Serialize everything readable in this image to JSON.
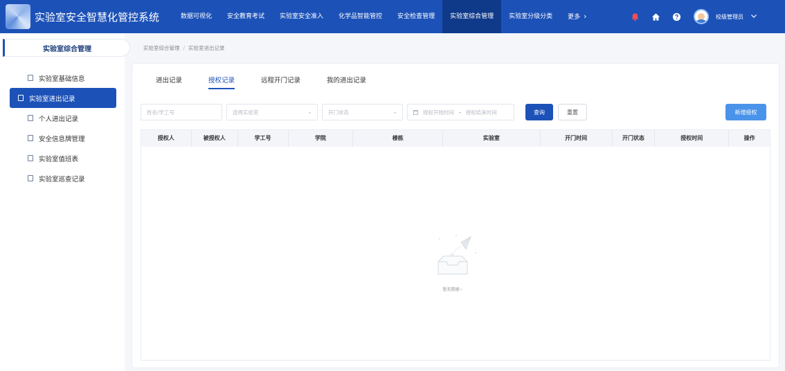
{
  "app": {
    "title": "实验室安全智慧化管控系统"
  },
  "nav": {
    "items": [
      "数据可视化",
      "安全教育考试",
      "实验室安全准入",
      "化学品智能管控",
      "安全检查管理",
      "实验室综合管理",
      "实验室分级分类",
      "更多"
    ],
    "active_index": 5
  },
  "user": {
    "name": "校级管理员"
  },
  "sidebar": {
    "header": "实验室综合管理",
    "items": [
      "实验室基础信息",
      "实验室进出记录",
      "个人进出记录",
      "安全信息牌管理",
      "实验室值班表",
      "实验室巡查记录"
    ],
    "active_index": 1
  },
  "breadcrumb": {
    "parent": "实验室综合管理",
    "separator": "/",
    "current": "实验室进出记录"
  },
  "tabs": {
    "items": [
      "进出记录",
      "授权记录",
      "远程开门记录",
      "我的进出记录"
    ],
    "active_index": 1
  },
  "filters": {
    "name_placeholder": "姓名/学工号",
    "lab_placeholder": "选择实验室",
    "door_status_placeholder": "开门状态",
    "start_placeholder": "授权开始时间",
    "range_separator": "-",
    "end_placeholder": "授权结束时间",
    "query_label": "查询",
    "reset_label": "重置",
    "add_label": "新增授权"
  },
  "table": {
    "columns": [
      "授权人",
      "被授权人",
      "学工号",
      "学院",
      "楼栋",
      "实验室",
      "开门时间",
      "开门状态",
      "授权时间",
      "操作"
    ],
    "rows": []
  },
  "empty": {
    "text": "暂无数据~"
  },
  "colors": {
    "primary": "#1c52b8",
    "nav_active": "#0f3a8a",
    "add_button": "#4a93ea",
    "bell": "#ff4d4f"
  }
}
